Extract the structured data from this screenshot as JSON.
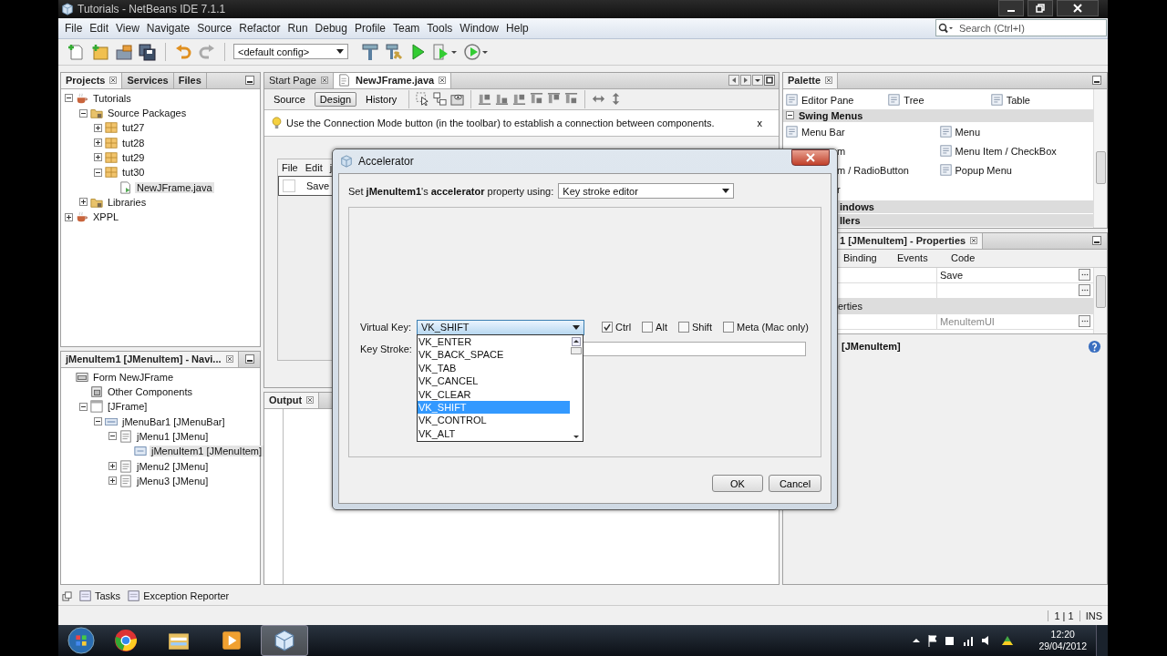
{
  "window": {
    "title": "Tutorials - NetBeans IDE 7.1.1"
  },
  "menu": [
    "File",
    "Edit",
    "View",
    "Navigate",
    "Source",
    "Refactor",
    "Run",
    "Debug",
    "Profile",
    "Team",
    "Tools",
    "Window",
    "Help"
  ],
  "search": {
    "placeholder": "Search (Ctrl+I)"
  },
  "toolbar": {
    "config": "<default config>"
  },
  "projects_panel": {
    "tabs": [
      {
        "label": "Projects",
        "selected": true
      },
      {
        "label": "Services",
        "selected": false
      },
      {
        "label": "Files",
        "selected": false
      }
    ],
    "tree": [
      {
        "label": "Tutorials",
        "kind": "project",
        "expanded": true,
        "selected": false,
        "children": [
          {
            "label": "Source Packages",
            "kind": "folder",
            "expanded": true,
            "selected": false,
            "children": [
              {
                "label": "tut27",
                "kind": "package",
                "expanded": false,
                "selected": false
              },
              {
                "label": "tut28",
                "kind": "package",
                "expanded": false,
                "selected": false
              },
              {
                "label": "tut29",
                "kind": "package",
                "expanded": false,
                "selected": false
              },
              {
                "label": "tut30",
                "kind": "package",
                "expanded": true,
                "selected": false,
                "children": [
                  {
                    "label": "NewJFrame.java",
                    "kind": "file",
                    "selected": true
                  }
                ]
              }
            ]
          },
          {
            "label": "Libraries",
            "kind": "folder",
            "expanded": false,
            "selected": false
          }
        ]
      },
      {
        "label": "XPPL",
        "kind": "project",
        "expanded": false,
        "selected": false
      }
    ]
  },
  "navigator_panel": {
    "title": "jMenuItem1 [JMenuItem] - Navi...",
    "tree": [
      {
        "label": "Form NewJFrame",
        "kind": "form",
        "selected": false,
        "children": [
          {
            "label": "Other Components",
            "kind": "components",
            "selected": false
          },
          {
            "label": "[JFrame]",
            "kind": "frame",
            "expanded": true,
            "selected": false,
            "children": [
              {
                "label": "jMenuBar1 [JMenuBar]",
                "kind": "menubar",
                "expanded": true,
                "selected": false,
                "children": [
                  {
                    "label": "jMenu1 [JMenu]",
                    "kind": "menu",
                    "expanded": true,
                    "selected": false,
                    "children": [
                      {
                        "label": "jMenuItem1 [JMenuItem]",
                        "kind": "menuitem",
                        "selected": true
                      }
                    ]
                  },
                  {
                    "label": "jMenu2 [JMenu]",
                    "kind": "menu",
                    "expanded": false,
                    "selected": false
                  },
                  {
                    "label": "jMenu3 [JMenu]",
                    "kind": "menu",
                    "expanded": false,
                    "selected": false
                  }
                ]
              }
            ]
          }
        ]
      }
    ]
  },
  "editor": {
    "tabs": [
      {
        "label": "Start Page",
        "selected": false
      },
      {
        "label": "NewJFrame.java",
        "selected": true
      }
    ],
    "views": [
      {
        "label": "Source",
        "selected": false
      },
      {
        "label": "Design",
        "selected": true
      },
      {
        "label": "History",
        "selected": false
      }
    ],
    "hint": "Use the Connection Mode button (in the toolbar) to establish a connection between components.",
    "hint_close": "x",
    "form": {
      "menus": [
        "File",
        "Edit",
        "j"
      ],
      "item": "Save"
    }
  },
  "output_panel": {
    "title": "Output"
  },
  "palette": {
    "title": "Palette",
    "top_items": [
      "Editor Pane",
      "Tree",
      "Table"
    ],
    "section": {
      "label": "Swing Menus",
      "expanded": true
    },
    "items": [
      {
        "label": "Menu Bar",
        "covered": false
      },
      {
        "label": "Menu",
        "covered": false
      },
      {
        "label": "m",
        "covered": true
      },
      {
        "label": "Menu Item / CheckBox",
        "covered": false
      },
      {
        "label": "m / RadioButton",
        "covered": true
      },
      {
        "label": "Popup Menu",
        "covered": false
      },
      {
        "label": "r",
        "covered": true
      }
    ],
    "more_sections": [
      "indows",
      "llers"
    ]
  },
  "properties": {
    "title": "1 [JMenuItem] - Properties",
    "tabs": [
      "Binding",
      "Events",
      "Code"
    ],
    "rows": [
      {
        "kind": "value",
        "value": "Save"
      },
      {
        "kind": "value"
      },
      {
        "kind": "section",
        "label": "erties"
      },
      {
        "kind": "value",
        "value": "MenuItemUI"
      }
    ],
    "footer": "[JMenuItem]"
  },
  "bottom_tabs": [
    "Tasks",
    "Exception Reporter"
  ],
  "status_bar": {
    "position": "1 | 1",
    "mode": "INS"
  },
  "dialog": {
    "title": "Accelerator",
    "prompt": "Set **jMenuItem1**'s **accelerator** property using:",
    "mode": "Key stroke editor",
    "virtual_key_label": "Virtual Key:",
    "virtual_key": "VK_SHIFT",
    "modifiers": [
      {
        "label": "Ctrl",
        "checked": true
      },
      {
        "label": "Alt",
        "checked": false
      },
      {
        "label": "Shift",
        "checked": false
      },
      {
        "label": "Meta (Mac only)",
        "checked": false
      }
    ],
    "key_stroke_label": "Key Stroke:",
    "key_list": [
      {
        "label": "VK_ENTER",
        "selected": false
      },
      {
        "label": "VK_BACK_SPACE",
        "selected": false
      },
      {
        "label": "VK_TAB",
        "selected": false
      },
      {
        "label": "VK_CANCEL",
        "selected": false
      },
      {
        "label": "VK_CLEAR",
        "selected": false
      },
      {
        "label": "VK_SHIFT",
        "selected": true
      },
      {
        "label": "VK_CONTROL",
        "selected": false
      },
      {
        "label": "VK_ALT",
        "selected": false
      }
    ],
    "buttons": [
      "OK",
      "Cancel"
    ]
  },
  "taskbar": {
    "apps": [
      {
        "kind": "chrome",
        "selected": false
      },
      {
        "kind": "folder",
        "selected": false
      },
      {
        "kind": "media",
        "selected": false
      },
      {
        "kind": "cube",
        "selected": true
      }
    ],
    "time": "12:20",
    "date": "29/04/2012"
  }
}
